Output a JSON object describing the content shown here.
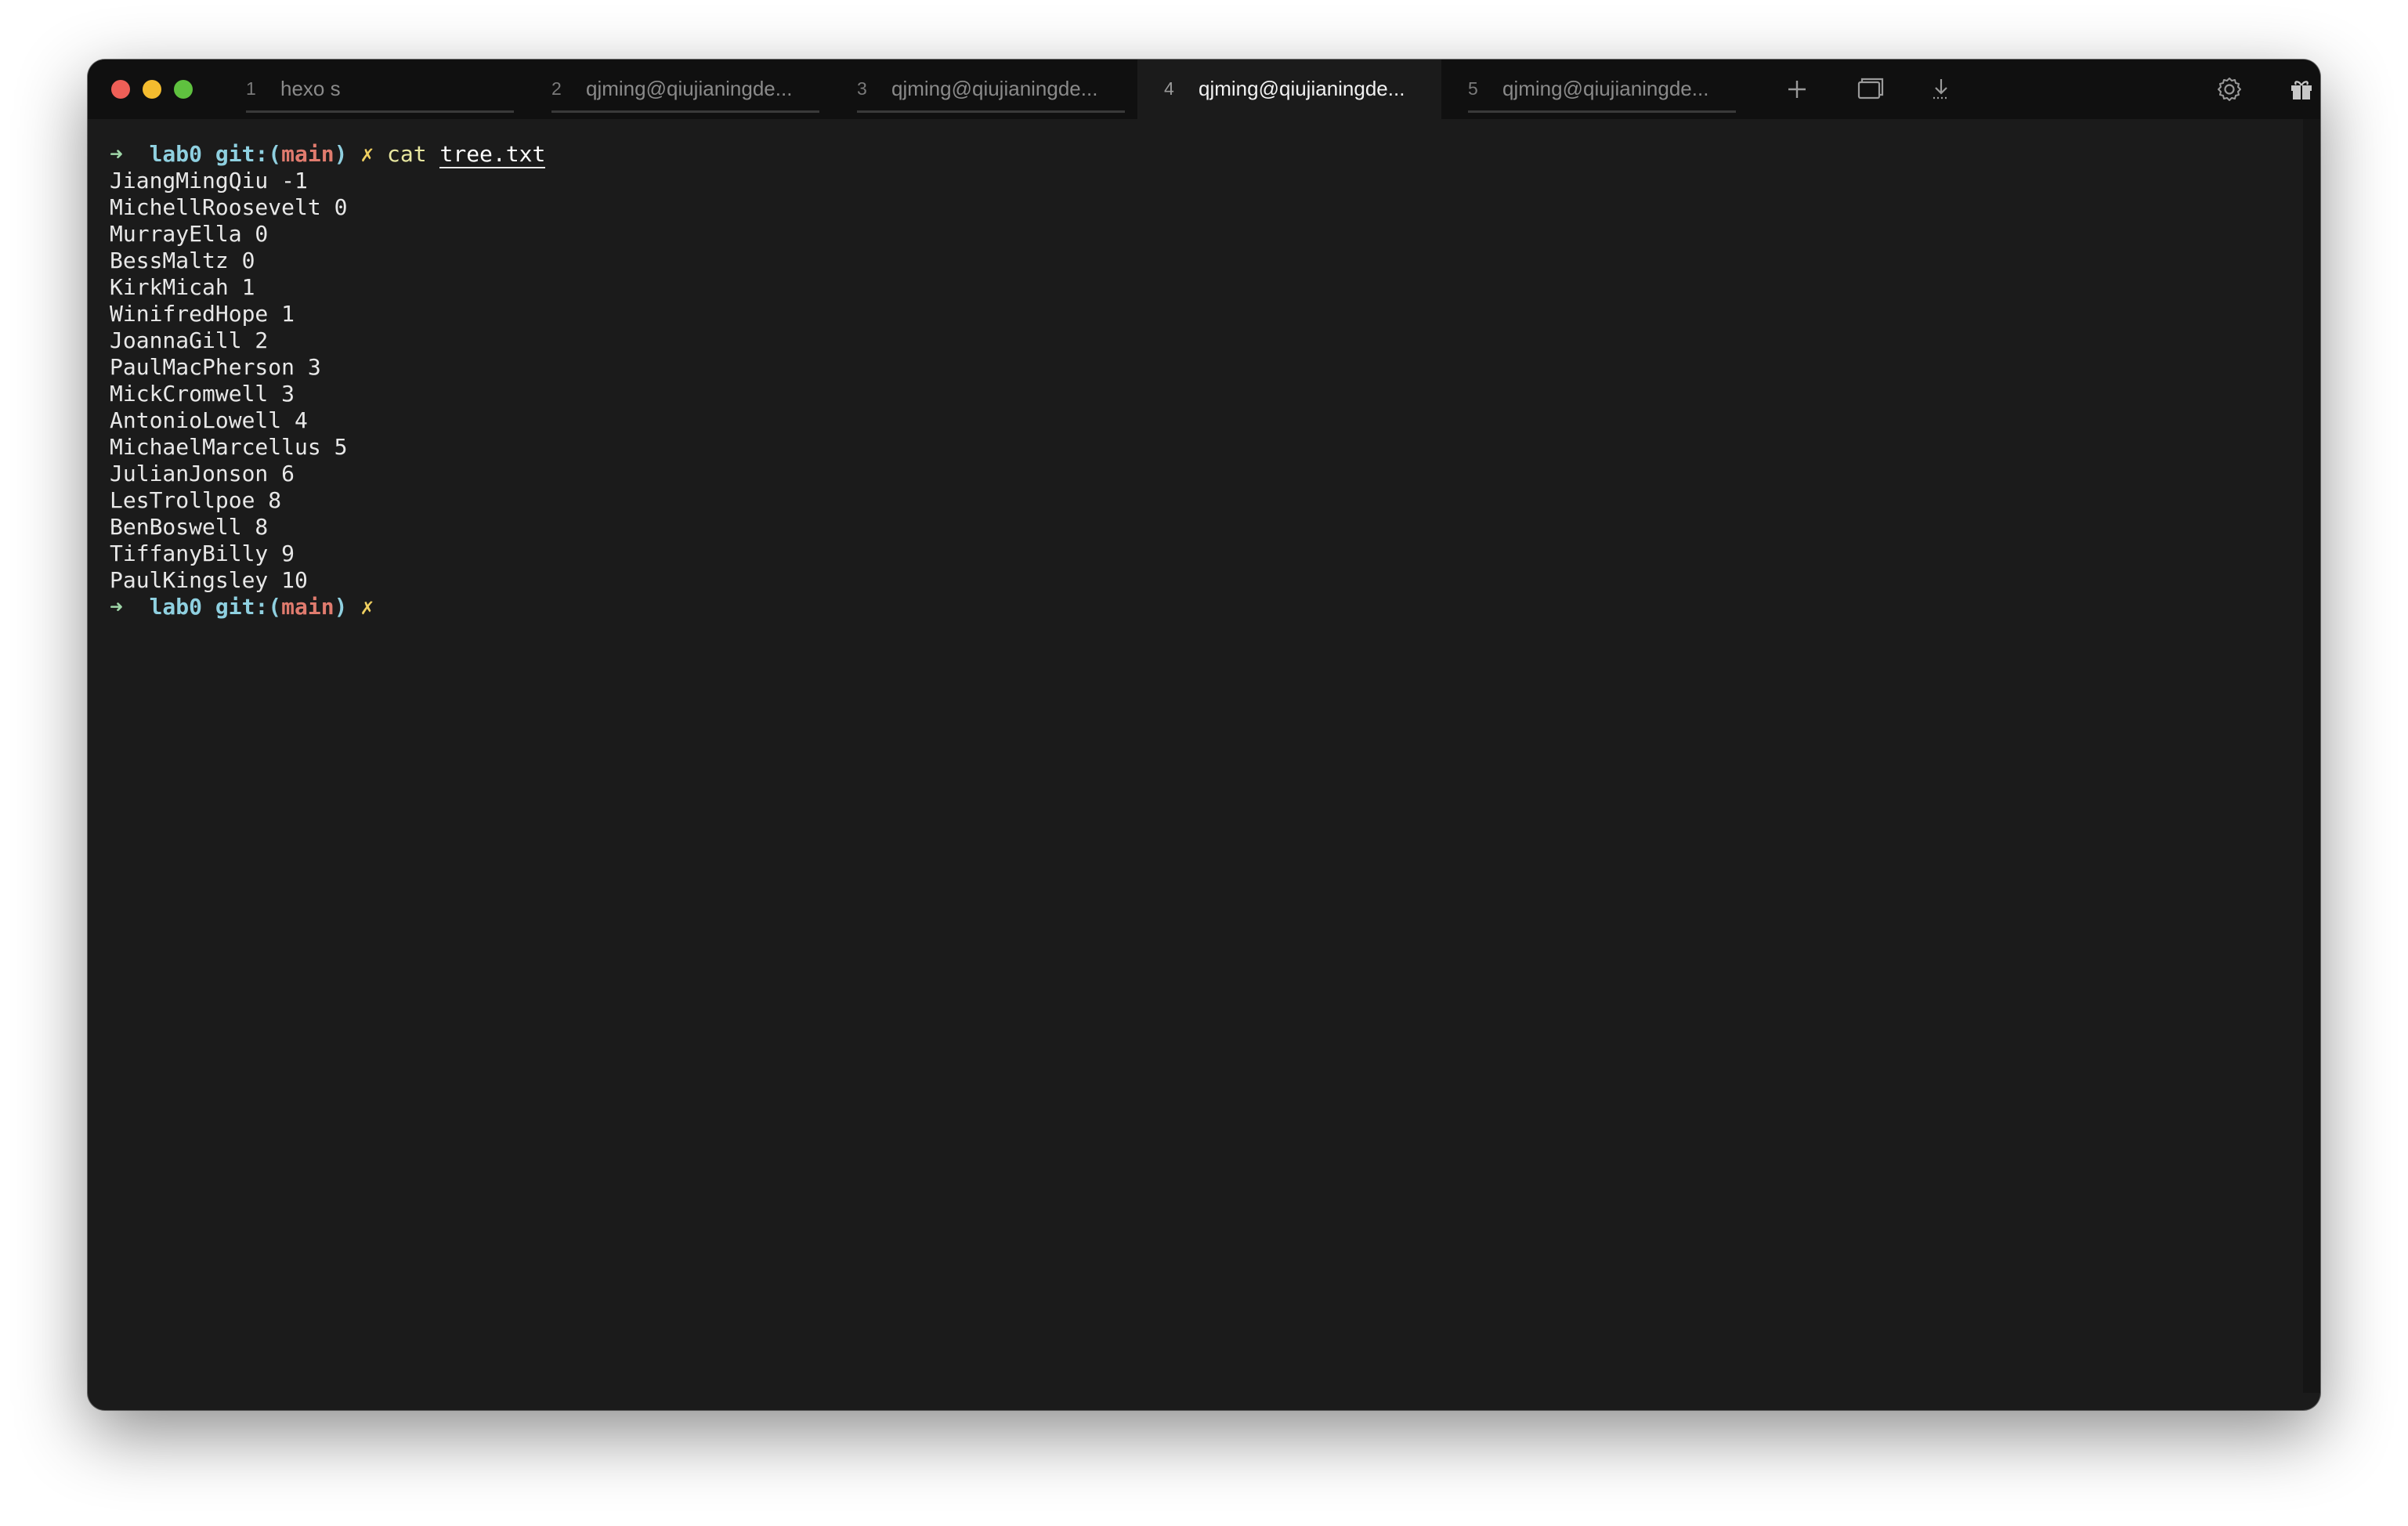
{
  "tabs": [
    {
      "num": "1",
      "title": "hexo s",
      "active": false
    },
    {
      "num": "2",
      "title": "qjming@qiujianingde...",
      "active": false
    },
    {
      "num": "3",
      "title": "qjming@qiujianingde...",
      "active": false
    },
    {
      "num": "4",
      "title": "qjming@qiujianingde...",
      "active": true
    },
    {
      "num": "5",
      "title": "qjming@qiujianingde...",
      "active": false
    }
  ],
  "toolbar": {
    "icons": [
      "plus-icon",
      "window-icon",
      "download-icon",
      "gear-icon",
      "gift-icon"
    ]
  },
  "prompt": {
    "arrow": "➜",
    "dir": "lab0",
    "git_prefix": "git:(",
    "branch": "main",
    "git_suffix": ")",
    "dirty": "✗"
  },
  "command": {
    "name": "cat",
    "argument": "tree.txt"
  },
  "output": [
    "JiangMingQiu -1",
    "MichellRoosevelt 0",
    "MurrayElla 0",
    "BessMaltz 0",
    "KirkMicah 1",
    "WinifredHope 1",
    "JoannaGill 2",
    "PaulMacPherson 3",
    "MickCromwell 3",
    "AntonioLowell 4",
    "MichaelMarcellus 5",
    "JulianJonson 6",
    "LesTrollpoe 8",
    "BenBoswell 8",
    "TiffanyBilly 9",
    "PaulKingsley 10"
  ],
  "colors": {
    "background": "#1b1b1b",
    "titlebar": "#101010",
    "prompt_dir": "#8fd0e0",
    "prompt_branch": "#e07b6e",
    "prompt_dirty": "#f0d060"
  }
}
